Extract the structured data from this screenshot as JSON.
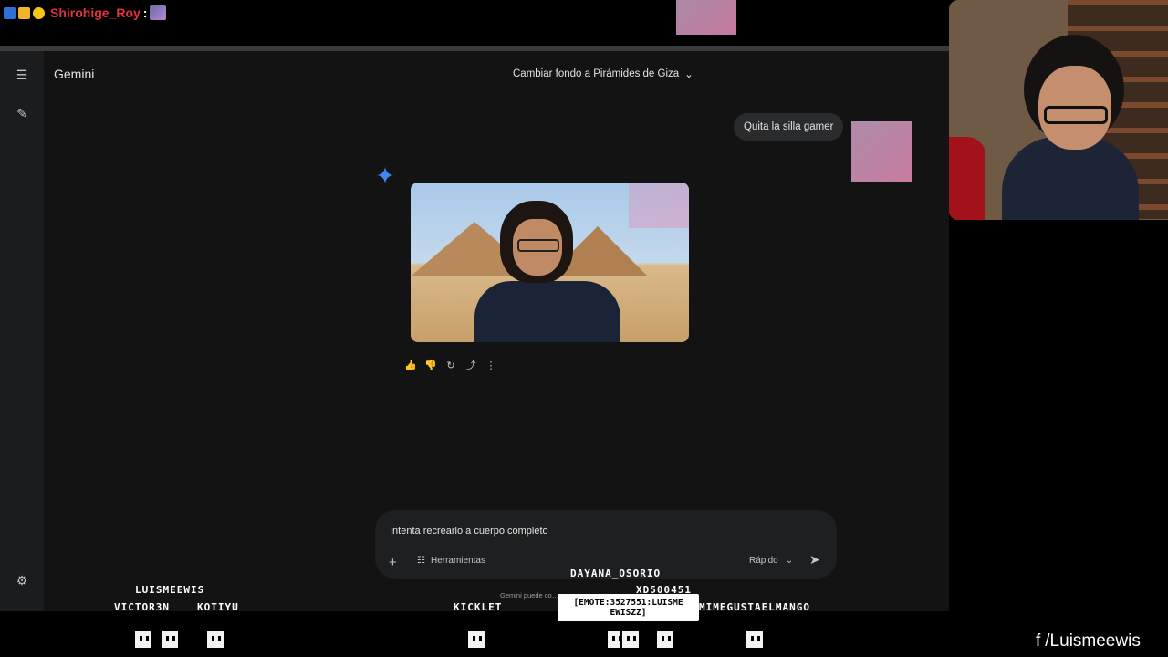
{
  "stream_chat": {
    "username": "Shirohige_Roy",
    "separator": ":"
  },
  "gemini": {
    "app_title": "Gemini",
    "chat_title": "Cambiar fondo a Pirámides de Giza",
    "user_message": "Quita la silla gamer",
    "input_value": "Intenta recrearlo a cuerpo completo",
    "tools_label": "Herramientas",
    "mode_label": "Rápido",
    "disclaimer": "Gemini puede co… …tas."
  },
  "stream_overlay": {
    "viewers": [
      {
        "name": "LUISMEEWIS"
      },
      {
        "name": "VICTOR3N"
      },
      {
        "name": "KOTIYU"
      },
      {
        "name": "KICKLET"
      },
      {
        "name": "DAYANA_OSORIO"
      },
      {
        "name": "XD500451"
      },
      {
        "name": "MIMEGUSTAELMANGO"
      }
    ],
    "emote_tooltip": "[EMOTE:3527551:LUISME EWISZZ]",
    "social_handle": "/Luismeewis"
  },
  "colors": {
    "gemini_bg": "#131314",
    "accent_red": "#e0323f",
    "sparkle_blue": "#4285f4"
  }
}
